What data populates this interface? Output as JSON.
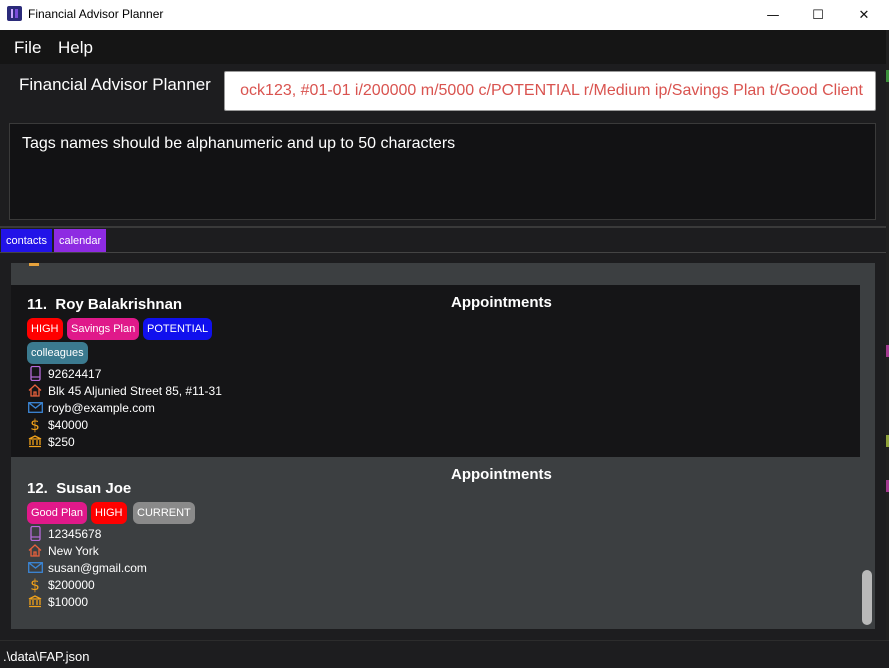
{
  "window": {
    "title": "Financial Advisor Planner",
    "minimize_glyph": "—",
    "maximize_glyph": "☐",
    "close_glyph": "✕"
  },
  "menu": {
    "file": "File",
    "help": "Help"
  },
  "header": {
    "app_label": "Financial Advisor Planner"
  },
  "command": {
    "value": "ock123, #01-01 i/200000 m/5000 c/POTENTIAL r/Medium ip/Savings Plan t/Good Client",
    "color": "#d9534f"
  },
  "result": {
    "message": "Tags names should be alphanumeric and up to 50 characters"
  },
  "tabs": [
    {
      "label": "contacts",
      "color": "#2213e8"
    },
    {
      "label": "calendar",
      "color": "#8e2be2"
    }
  ],
  "persons": [
    {
      "index": "11.",
      "name": "Roy Balakrishnan",
      "appointments_label": "Appointments",
      "tags": [
        {
          "label": "HIGH",
          "color": "#ff0000"
        },
        {
          "label": "Savings Plan",
          "color": "#e0198a"
        },
        {
          "label": "POTENTIAL",
          "color": "#1010ee"
        },
        {
          "label": "colleagues",
          "color": "#3b7a8f"
        }
      ],
      "phone": "92624417",
      "address": "Blk 45 Aljunied Street 85, #11-31",
      "email": "royb@example.com",
      "income": "$40000",
      "monthly": "$250"
    },
    {
      "index": "12.",
      "name": "Susan Joe",
      "appointments_label": "Appointments",
      "tags": [
        {
          "label": "Good Plan",
          "color": "#e0198a"
        },
        {
          "label": "HIGH",
          "color": "#ff0000"
        },
        {
          "label": "CURRENT",
          "color": "#8a8a8a"
        }
      ],
      "phone": "12345678",
      "address": "New York",
      "email": "susan@gmail.com",
      "income": "$200000",
      "monthly": "$10000"
    }
  ],
  "icons": {
    "phone": "phone-icon",
    "address": "home-icon",
    "email": "mail-icon",
    "income": "dollar-icon",
    "monthly": "bank-icon"
  },
  "status": {
    "path": ".\\data\\FAP.json"
  }
}
